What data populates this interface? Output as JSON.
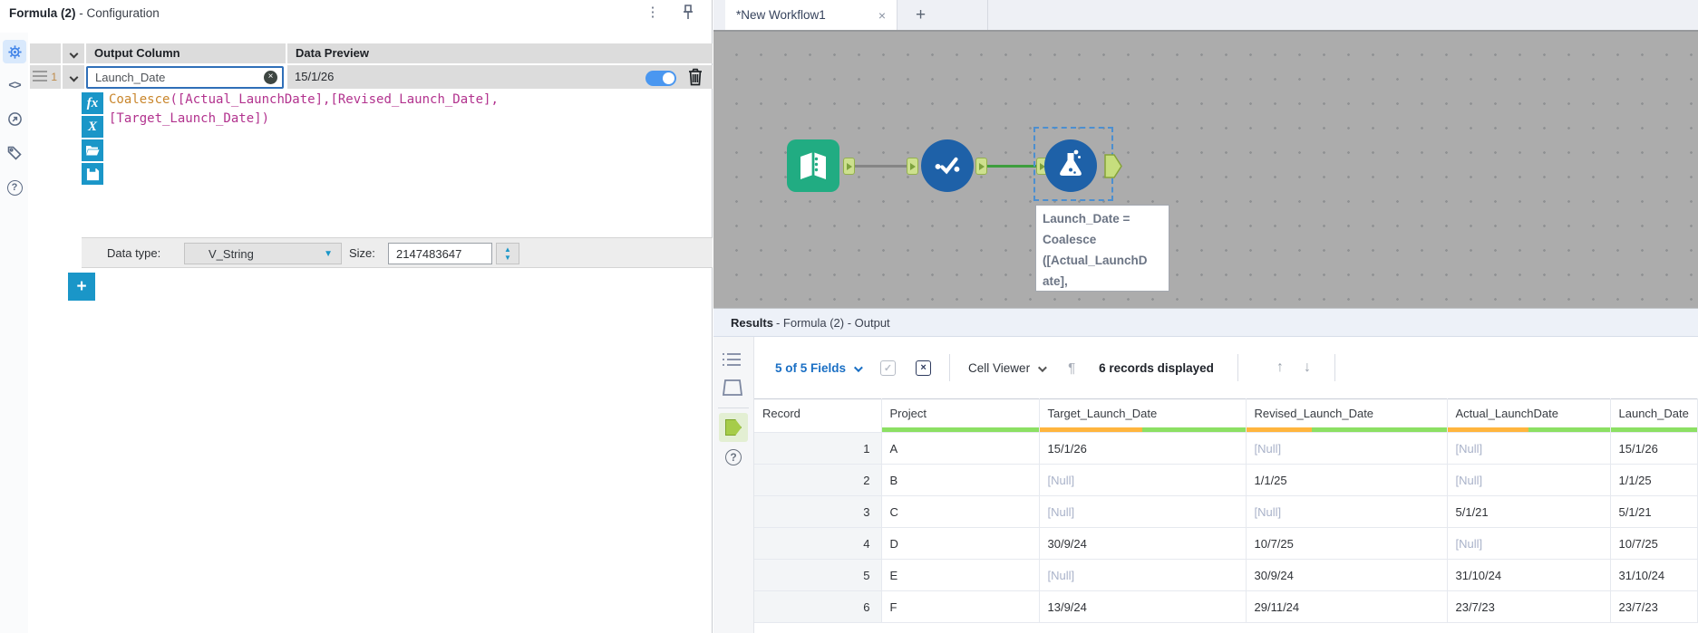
{
  "config": {
    "title": "Formula (2)",
    "title_suffix": " - Configuration",
    "header": {
      "output_column": "Output Column",
      "data_preview": "Data Preview"
    },
    "row1": {
      "index": "1",
      "name": "Launch_Date",
      "preview": "15/1/26"
    },
    "formula": {
      "function": "Coalesce",
      "line1_rest": "([Actual_LaunchDate],[Revised_Launch_Date],",
      "line2": "[Target_Launch_Date])"
    },
    "footer": {
      "data_type_label": "Data type:",
      "data_type": "V_String",
      "size_label": "Size:",
      "size": "2147483647"
    }
  },
  "workflow": {
    "tab": "*New Workflow1",
    "annotation": [
      "Launch_Date =",
      "Coalesce",
      "([Actual_LaunchD",
      "ate],"
    ]
  },
  "results": {
    "title": "Results",
    "title_suffix": " - Formula (2) - Output",
    "toolbar": {
      "fields": "5 of 5 Fields",
      "cell_viewer": "Cell Viewer",
      "records": "6 records displayed"
    },
    "table": {
      "headers": [
        "Record",
        "Project",
        "Target_Launch_Date",
        "Revised_Launch_Date",
        "Actual_LaunchDate",
        "Launch_Date"
      ],
      "quality": [
        null,
        0,
        0.5,
        0.33,
        0.5,
        0
      ],
      "rows": [
        [
          "1",
          "A",
          "15/1/26",
          "[Null]",
          "[Null]",
          "15/1/26"
        ],
        [
          "2",
          "B",
          "[Null]",
          "1/1/25",
          "[Null]",
          "1/1/25"
        ],
        [
          "3",
          "C",
          "[Null]",
          "[Null]",
          "5/1/21",
          "5/1/21"
        ],
        [
          "4",
          "D",
          "30/9/24",
          "10/7/25",
          "[Null]",
          "10/7/25"
        ],
        [
          "5",
          "E",
          "[Null]",
          "30/9/24",
          "31/10/24",
          "31/10/24"
        ],
        [
          "6",
          "F",
          "13/9/24",
          "29/11/24",
          "23/7/23",
          "23/7/23"
        ]
      ]
    }
  },
  "icons": {
    "kebab": "⋮",
    "code": "<>",
    "help": "?",
    "close": "×",
    "add": "+",
    "fx": "fx",
    "variable": "X",
    "pilcrow": "¶",
    "up_arrow": "↑",
    "down_arrow": "↓",
    "dropdown_arrow": "▼",
    "stepper_up": "▲",
    "stepper_down": "▼"
  },
  "colors": {
    "accent_blue": "#1a96c8",
    "tool_blue": "#1e61a8",
    "tool_green": "#21ac82",
    "link_blue": "#1a6fc4",
    "null_text": "#a9b2c9",
    "quality_green": "#8ce063",
    "quality_orange": "#ffb53e",
    "focus_border": "#2f6fb8"
  }
}
